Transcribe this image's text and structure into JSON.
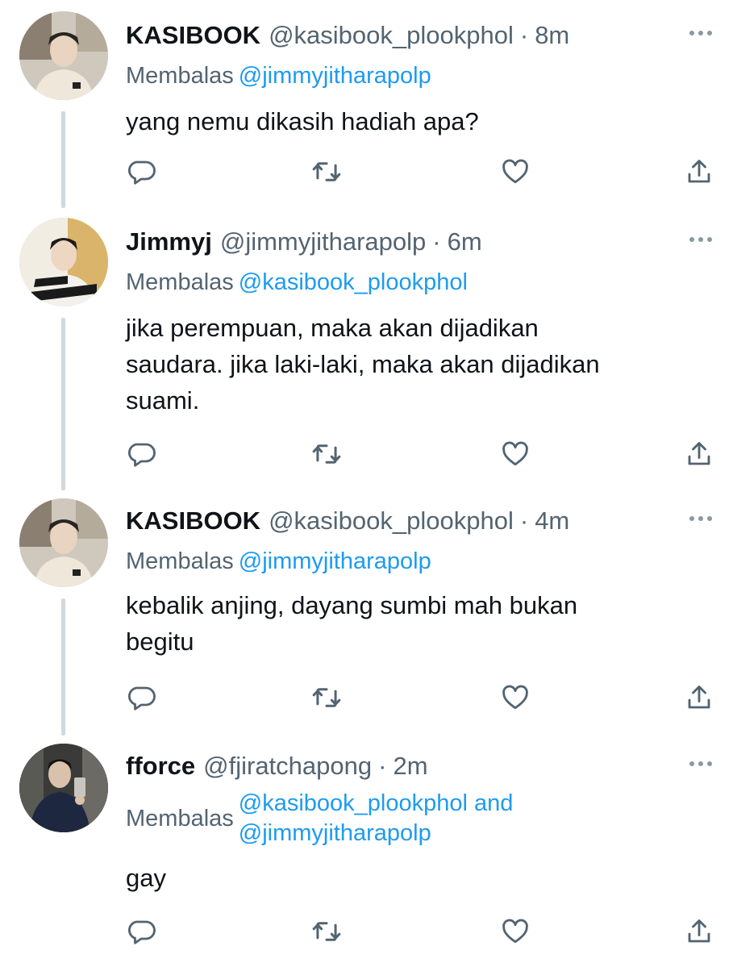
{
  "thread": [
    {
      "name": "KASIBOOK",
      "handle": "@kasibook_plookphol",
      "separator": "·",
      "time": "8m",
      "replying_label": "Membalas",
      "mentions": [
        "@jimmyjitharapolp"
      ],
      "text_lines": [
        "yang nemu dikasih hadiah apa?"
      ]
    },
    {
      "name": "Jimmyj",
      "handle": "@jimmyjitharapolp",
      "separator": "·",
      "time": "6m",
      "replying_label": "Membalas",
      "mentions": [
        "@kasibook_plookphol"
      ],
      "text_lines": [
        "jika perempuan, maka akan dijadikan",
        "saudara. jika laki-laki, maka akan dijadikan",
        "suami."
      ]
    },
    {
      "name": "KASIBOOK",
      "handle": "@kasibook_plookphol",
      "separator": "·",
      "time": "4m",
      "replying_label": "Membalas",
      "mentions": [
        "@jimmyjitharapolp"
      ],
      "text_lines": [
        "kebalik anjing, dayang sumbi mah bukan",
        "begitu"
      ]
    },
    {
      "name": "fforce",
      "handle": "@fjiratchapong",
      "separator": "·",
      "time": "2m",
      "replying_label": "Membalas",
      "mentions": [
        "@kasibook_plookphol and",
        "@jimmyjitharapolp"
      ],
      "text_lines": [
        "gay"
      ]
    }
  ],
  "icons": {
    "reply": "reply-icon",
    "retweet": "retweet-icon",
    "like": "like-icon",
    "share": "share-icon",
    "more": "more-icon"
  },
  "colors": {
    "text": "#0f1419",
    "secondary": "#536471",
    "link": "#1d9bf0",
    "thread_line": "#cfd9de"
  }
}
